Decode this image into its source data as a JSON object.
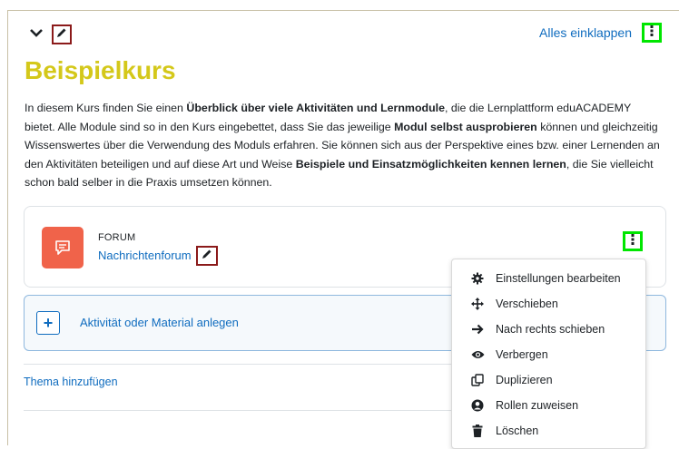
{
  "header": {
    "collapse_all": "Alles einklappen"
  },
  "course": {
    "title": "Beispielkurs",
    "description": [
      {
        "text": "In diesem Kurs finden Sie einen ",
        "bold": false
      },
      {
        "text": "Überblick über viele Aktivitäten und Lernmodule",
        "bold": true
      },
      {
        "text": ", die die Lernplattform eduACADEMY bietet. Alle Module sind so in den Kurs eingebettet, dass Sie das jeweilige ",
        "bold": false
      },
      {
        "text": "Modul selbst ausprobieren",
        "bold": true
      },
      {
        "text": " können und gleichzeitig Wissenswertes über die Verwendung des Moduls erfahren. Sie können sich aus der Perspektive eines bzw. einer Lernenden an den Aktivitäten beteiligen und auf diese Art und Weise ",
        "bold": false
      },
      {
        "text": "Beispiele und Einsatzmöglichkeiten kennen lernen",
        "bold": true
      },
      {
        "text": ", die Sie vielleicht schon bald selber in die Praxis umsetzen können.",
        "bold": false
      }
    ]
  },
  "activity": {
    "type_label": "FORUM",
    "name": "Nachrichtenforum",
    "icon": "forum-chat-icon",
    "icon_color": "#f0634a"
  },
  "add_activity": {
    "label": "Aktivität oder Material anlegen",
    "plus": "+"
  },
  "add_topic": "Thema hinzufügen",
  "menu": {
    "items": [
      {
        "label": "Einstellungen bearbeiten",
        "icon": "gear-icon"
      },
      {
        "label": "Verschieben",
        "icon": "move-icon"
      },
      {
        "label": "Nach rechts schieben",
        "icon": "arrow-right-icon"
      },
      {
        "label": "Verbergen",
        "icon": "eye-icon"
      },
      {
        "label": "Duplizieren",
        "icon": "duplicate-icon"
      },
      {
        "label": "Rollen zuweisen",
        "icon": "user-circle-icon"
      },
      {
        "label": "Löschen",
        "icon": "trash-icon"
      }
    ]
  },
  "colors": {
    "link": "#0f6cbf",
    "title": "#d4c81a",
    "highlight_edit": "#8b1a1a",
    "highlight_menu": "#00e600"
  }
}
